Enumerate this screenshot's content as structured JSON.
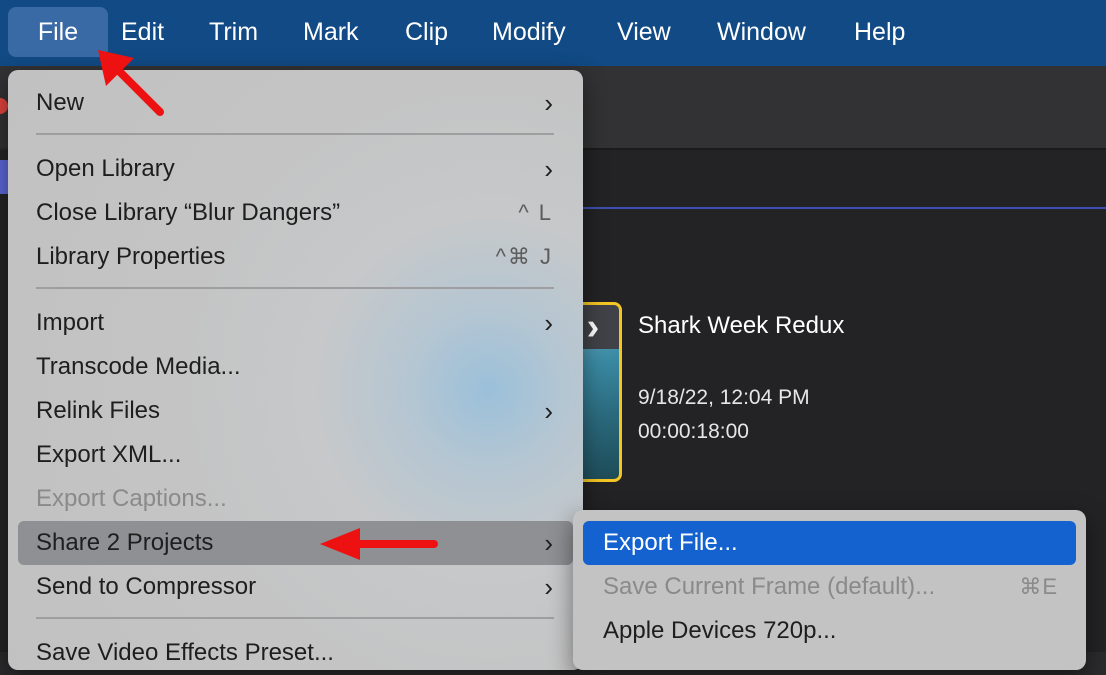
{
  "menubar": {
    "items": [
      "File",
      "Edit",
      "Trim",
      "Mark",
      "Clip",
      "Modify",
      "View",
      "Window",
      "Help"
    ],
    "active": "File"
  },
  "project": {
    "title": "Shark Week Redux",
    "date": "9/18/22, 12:04 PM",
    "duration": "00:00:18:00"
  },
  "file_menu": {
    "new": "New",
    "open_library": "Open Library",
    "close_library": "Close Library “Blur Dangers”",
    "close_library_shortcut": "^ L",
    "library_properties": "Library Properties",
    "library_properties_shortcut": "^⌘ J",
    "import": "Import",
    "transcode_media": "Transcode Media...",
    "relink_files": "Relink Files",
    "export_xml": "Export XML...",
    "export_captions": "Export Captions...",
    "share_projects": "Share 2 Projects",
    "send_to_compressor": "Send to Compressor",
    "save_video_effects_preset": "Save Video Effects Preset..."
  },
  "share_submenu": {
    "export_file": "Export File...",
    "save_current_frame": "Save Current Frame (default)...",
    "save_current_frame_shortcut": "⌘E",
    "apple_devices": "Apple Devices 720p..."
  },
  "colors": {
    "menubar": "#114a84",
    "selection": "#1362cf",
    "annotation_arrow": "#ee1111",
    "thumbnail_border": "#f3c623"
  },
  "icons": {
    "submenu_indicator": "chevron-right-icon",
    "annotation": "red-arrow"
  }
}
